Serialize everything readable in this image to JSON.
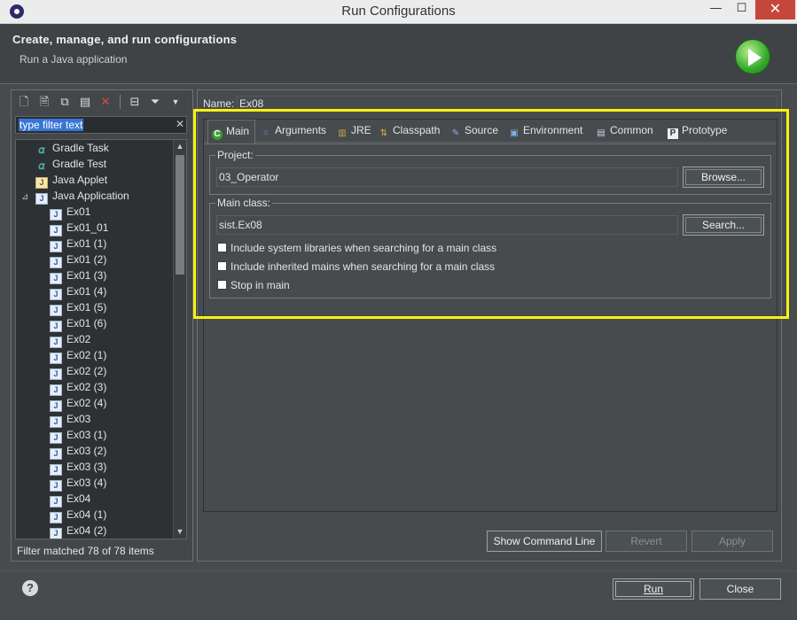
{
  "window": {
    "title": "Run Configurations",
    "minimize": "—",
    "maximize": "☐",
    "close": "✕"
  },
  "header": {
    "title": "Create, manage, and run configurations",
    "subtitle": "Run a Java application"
  },
  "left": {
    "toolbar": [
      "new-configuration",
      "new-prototype",
      "duplicate",
      "export",
      "delete",
      "collapse-all",
      "filter",
      "view-menu"
    ],
    "filter_placeholder": "type filter text",
    "filter_clear": "✕",
    "tree": [
      {
        "label": "Gradle Task",
        "icon": "gradle-icon",
        "level": 1
      },
      {
        "label": "Gradle Test",
        "icon": "gradle-icon",
        "level": 1
      },
      {
        "label": "Java Applet",
        "icon": "applet-icon",
        "level": 1
      },
      {
        "label": "Java Application",
        "icon": "java-app-icon",
        "level": 1,
        "expanded": true
      },
      {
        "label": "Ex01",
        "icon": "java-config-icon",
        "level": 2
      },
      {
        "label": "Ex01_01",
        "icon": "java-config-icon",
        "level": 2
      },
      {
        "label": "Ex01 (1)",
        "icon": "java-config-icon",
        "level": 2
      },
      {
        "label": "Ex01 (2)",
        "icon": "java-config-icon",
        "level": 2
      },
      {
        "label": "Ex01 (3)",
        "icon": "java-config-icon",
        "level": 2
      },
      {
        "label": "Ex01 (4)",
        "icon": "java-config-icon",
        "level": 2
      },
      {
        "label": "Ex01 (5)",
        "icon": "java-config-icon",
        "level": 2
      },
      {
        "label": "Ex01 (6)",
        "icon": "java-config-icon",
        "level": 2
      },
      {
        "label": "Ex02",
        "icon": "java-config-icon",
        "level": 2
      },
      {
        "label": "Ex02 (1)",
        "icon": "java-config-icon",
        "level": 2
      },
      {
        "label": "Ex02 (2)",
        "icon": "java-config-icon",
        "level": 2
      },
      {
        "label": "Ex02 (3)",
        "icon": "java-config-icon",
        "level": 2
      },
      {
        "label": "Ex02 (4)",
        "icon": "java-config-icon",
        "level": 2
      },
      {
        "label": "Ex03",
        "icon": "java-config-icon",
        "level": 2
      },
      {
        "label": "Ex03 (1)",
        "icon": "java-config-icon",
        "level": 2
      },
      {
        "label": "Ex03 (2)",
        "icon": "java-config-icon",
        "level": 2
      },
      {
        "label": "Ex03 (3)",
        "icon": "java-config-icon",
        "level": 2
      },
      {
        "label": "Ex03 (4)",
        "icon": "java-config-icon",
        "level": 2
      },
      {
        "label": "Ex04",
        "icon": "java-config-icon",
        "level": 2
      },
      {
        "label": "Ex04 (1)",
        "icon": "java-config-icon",
        "level": 2
      },
      {
        "label": "Ex04 (2)",
        "icon": "java-config-icon",
        "level": 2
      }
    ],
    "filter_status": "Filter matched 78 of 78 items"
  },
  "right": {
    "name_label": "Name:",
    "name_value": "Ex08",
    "tabs": [
      {
        "label": "Main",
        "icon": "main-tab-icon",
        "active": true
      },
      {
        "label": "Arguments",
        "icon": "arguments-tab-icon"
      },
      {
        "label": "JRE",
        "icon": "jre-tab-icon"
      },
      {
        "label": "Classpath",
        "icon": "classpath-tab-icon"
      },
      {
        "label": "Source",
        "icon": "source-tab-icon"
      },
      {
        "label": "Environment",
        "icon": "environment-tab-icon"
      },
      {
        "label": "Common",
        "icon": "common-tab-icon"
      },
      {
        "label": "Prototype",
        "icon": "prototype-tab-icon"
      }
    ],
    "project": {
      "label": "Project:",
      "value": "03_Operator",
      "browse_label": "Browse..."
    },
    "main_class": {
      "label": "Main class:",
      "value": "sist.Ex08",
      "search_label": "Search..."
    },
    "checks": [
      {
        "label": "Include system libraries when searching for a main class",
        "checked": false
      },
      {
        "label": "Include inherited mains when searching for a main class",
        "checked": false
      },
      {
        "label": "Stop in main",
        "checked": false
      }
    ],
    "show_command_line": "Show Command Line",
    "revert": "Revert",
    "apply": "Apply"
  },
  "footer": {
    "help": "?",
    "run": "Run",
    "close": "Close"
  },
  "colors": {
    "highlight": "#f7f211",
    "selection": "#3875d7",
    "background": "#474b4e"
  }
}
